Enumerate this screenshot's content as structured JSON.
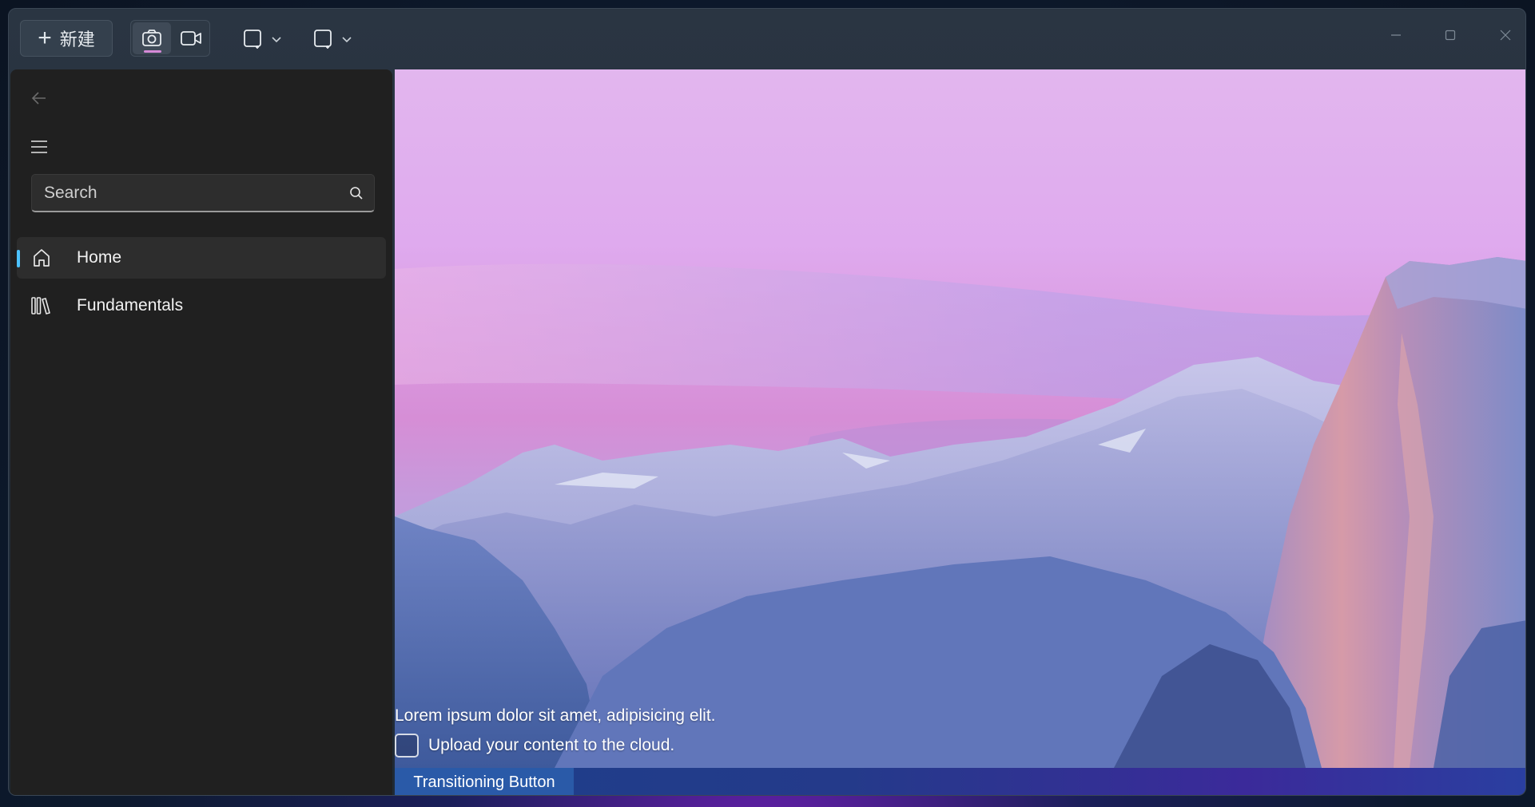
{
  "toolbar": {
    "new_label": "新建",
    "photo_mode": "camera-icon",
    "video_mode": "video-icon"
  },
  "sidebar": {
    "search": {
      "placeholder": "Search",
      "value": ""
    },
    "items": [
      {
        "label": "Home",
        "icon": "home-icon",
        "selected": true
      },
      {
        "label": "Fundamentals",
        "icon": "library-icon",
        "selected": false
      }
    ]
  },
  "content": {
    "lorem_text": "Lorem ipsum dolor sit amet, adipisicing elit.",
    "checkbox_label": "Upload your content to the cloud.",
    "checkbox_checked": false,
    "button_label": "Transitioning Button"
  },
  "colors": {
    "accent": "#4cc2ff",
    "mode_indicator": "#d58ad8",
    "sidebar_bg": "#202020"
  }
}
